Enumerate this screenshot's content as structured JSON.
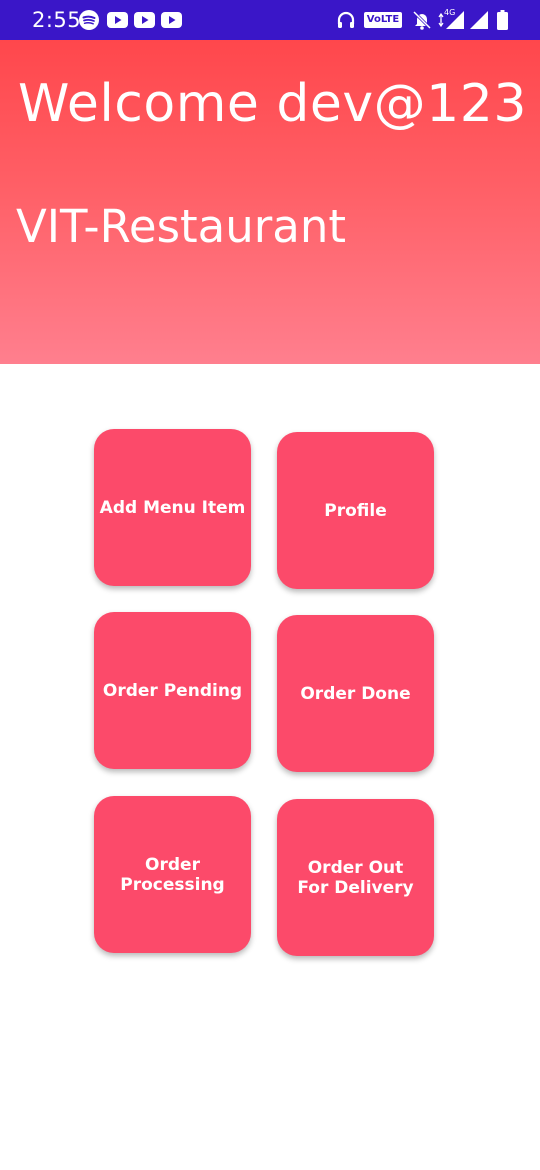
{
  "status_bar": {
    "time": "2:55",
    "volte": "VoLTE",
    "network": "4G",
    "icons": [
      "spotify-icon",
      "youtube-icon",
      "youtube-icon",
      "youtube-icon",
      "headphones-icon",
      "volte-icon",
      "mute-icon",
      "signal-icon",
      "signal-icon",
      "battery-icon"
    ]
  },
  "header": {
    "welcome": "Welcome dev@123",
    "restaurant": "VIT-Restaurant"
  },
  "tiles": {
    "add_menu_item": "Add Menu Item",
    "profile": "Profile",
    "order_pending": "Order Pending",
    "order_done": "Order Done",
    "order_processing": "Order Processing",
    "order_out_for_delivery": "Order Out\nFor Delivery"
  },
  "colors": {
    "status_bar": "#3a16c8",
    "header_top": "#ff474c",
    "header_bottom": "#ff7f8e",
    "tile": "#fc4a6a"
  }
}
